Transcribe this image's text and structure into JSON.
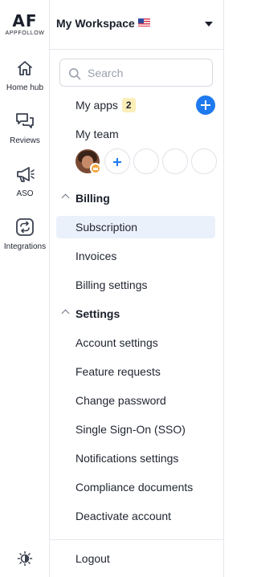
{
  "app": {
    "logo_text": "AF",
    "logo_subtext": "APPFOLLOW"
  },
  "rail": {
    "items": [
      {
        "label": "Home hub",
        "icon": "home-icon"
      },
      {
        "label": "Reviews",
        "icon": "chat-bubbles-icon"
      },
      {
        "label": "ASO",
        "icon": "megaphone-icon"
      },
      {
        "label": "Integrations",
        "icon": "integrations-icon"
      }
    ],
    "theme_icon": "theme-toggle-icon"
  },
  "workspace": {
    "name": "My Workspace",
    "flag": "US",
    "caret_icon": "caret-down-icon"
  },
  "search": {
    "placeholder": "Search",
    "value": ""
  },
  "my_apps": {
    "label": "My apps",
    "count": "2"
  },
  "my_team": {
    "label": "My team"
  },
  "billing": {
    "title": "Billing",
    "items": [
      "Subscription",
      "Invoices",
      "Billing settings"
    ],
    "active": "Subscription"
  },
  "settings": {
    "title": "Settings",
    "items": [
      "Account settings",
      "Feature requests",
      "Change password",
      "Single Sign-On (SSO)",
      "Notifications settings",
      "Compliance documents",
      "Deactivate account"
    ]
  },
  "logout": {
    "label": "Logout"
  },
  "colors": {
    "accent": "#1f7aef",
    "active_bg": "#eaf1fb",
    "badge_bg": "#fbeeb8"
  }
}
